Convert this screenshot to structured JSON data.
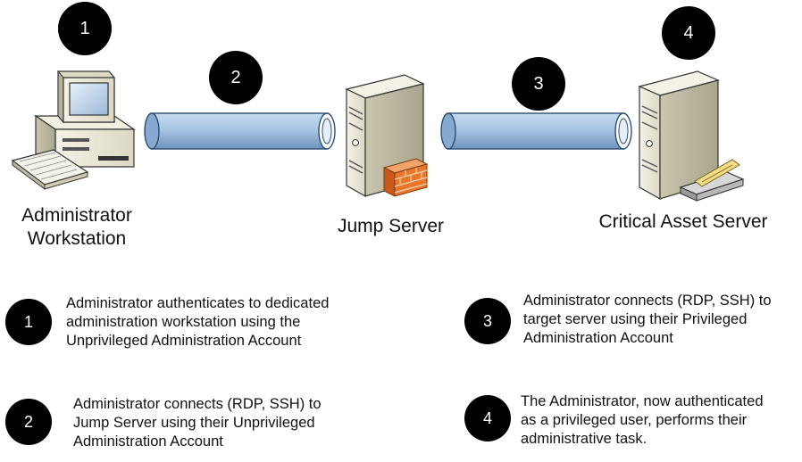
{
  "steps": [
    {
      "number": "1",
      "text_lines": [
        "Administrator authenticates to dedicated",
        "administration workstation using the",
        "Unprivileged Administration Account"
      ]
    },
    {
      "number": "2",
      "text_lines": [
        "Administrator connects (RDP, SSH) to",
        "Jump Server using their Unprivileged",
        "Administration Account"
      ]
    },
    {
      "number": "3",
      "text_lines": [
        "Administrator connects (RDP, SSH) to",
        "target server using their Privileged",
        "Administration Account"
      ]
    },
    {
      "number": "4",
      "text_lines": [
        "The Administrator, now authenticated",
        "as a privileged user, performs their",
        "administrative task."
      ]
    }
  ],
  "nodes": {
    "workstation": {
      "label_lines": [
        "Administrator",
        "Workstation"
      ],
      "icon": "workstation-icon"
    },
    "jump_server": {
      "label": "Jump Server",
      "icon": "server-firewall-icon"
    },
    "critical_server": {
      "label": "Critical Asset Server",
      "icon": "server-keycard-icon"
    }
  },
  "connections": [
    {
      "from": "Administrator Workstation",
      "to": "Jump Server",
      "step": "2",
      "icon": "tunnel-pipe-icon"
    },
    {
      "from": "Jump Server",
      "to": "Critical Asset Server",
      "step": "3",
      "icon": "tunnel-pipe-icon"
    }
  ],
  "colors": {
    "badge": "#000000",
    "pipe": "#9bbbd9",
    "pipe_shadow": "#5a7fa6",
    "firewall": "#e8762b",
    "server_case": "#ece9d8"
  }
}
